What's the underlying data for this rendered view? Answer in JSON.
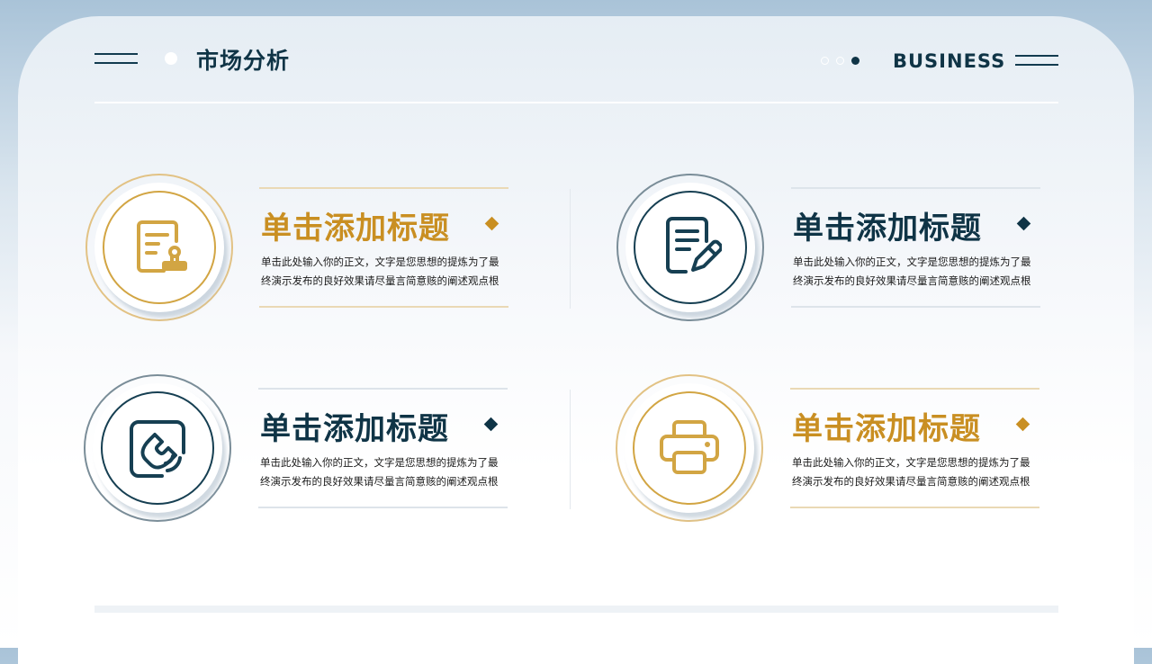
{
  "header": {
    "title": "市场分析",
    "label": "BUSINESS"
  },
  "colors": {
    "navy": "#0f3446",
    "gold": "#c98f22",
    "background_top": "#a9c3d8"
  },
  "cards": [
    {
      "title": "单击添加标题",
      "body_lines": [
        "单击此处输入你的正文，文字是您思想的提炼为了最",
        "终演示发布的良好效果请尽量言简意赅的阐述观点根"
      ],
      "icon": "document-stamp-icon",
      "accent": "gold"
    },
    {
      "title": "单击添加标题",
      "body_lines": [
        "单击此处输入你的正文，文字是您思想的提炼为了最",
        "终演示发布的良好效果请尽量言简意赅的阐述观点根"
      ],
      "icon": "document-edit-icon",
      "accent": "navy"
    },
    {
      "title": "单击添加标题",
      "body_lines": [
        "单击此处输入你的正文，文字是您思想的提炼为了最",
        "终演示发布的良好效果请尽量言简意赅的阐述观点根"
      ],
      "icon": "phone-signal-icon",
      "accent": "navy"
    },
    {
      "title": "单击添加标题",
      "body_lines": [
        "单击此处输入你的正文，文字是您思想的提炼为了最",
        "终演示发布的良好效果请尽量言简意赅的阐述观点根"
      ],
      "icon": "printer-icon",
      "accent": "gold"
    }
  ]
}
